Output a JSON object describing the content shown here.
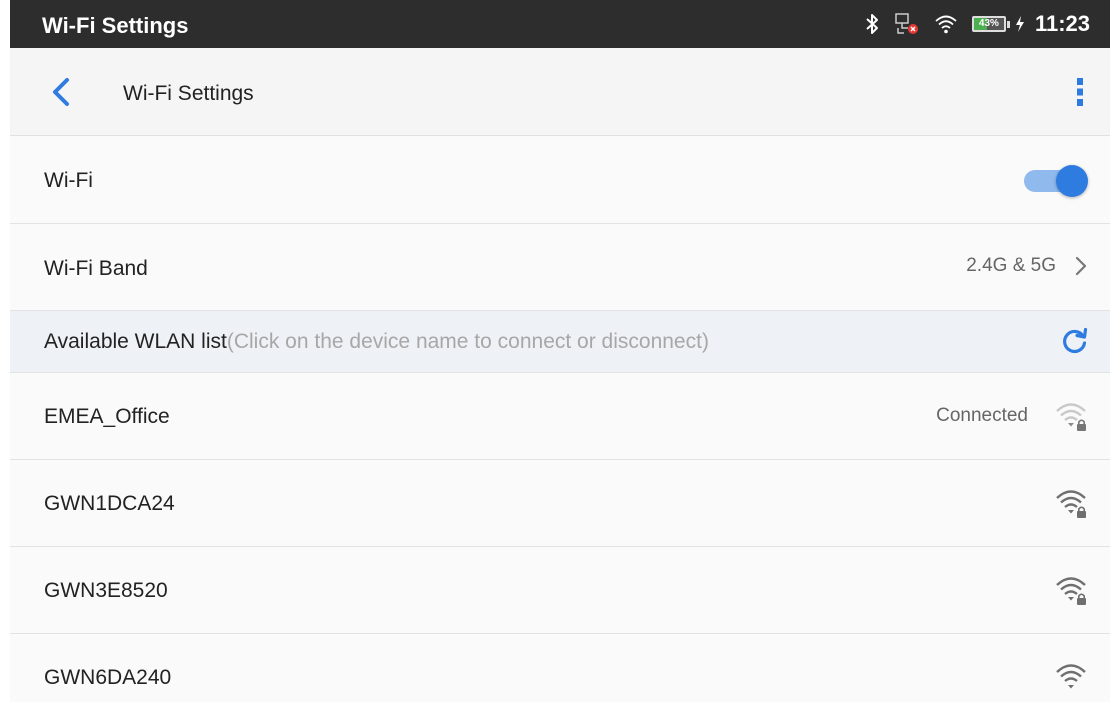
{
  "status_bar": {
    "title": "Wi-Fi Settings",
    "battery": {
      "text": "43%",
      "level": 0.43
    },
    "time": "11:23",
    "icons": [
      "bluetooth-icon",
      "ethernet-disconnected-icon",
      "wifi-icon",
      "battery-icon",
      "charging-icon"
    ]
  },
  "app_bar": {
    "title": "Wi-Fi Settings",
    "back_icon": "chevron-left-icon",
    "menu_icon": "more-vertical-icon"
  },
  "settings": {
    "wifi": {
      "label": "Wi-Fi",
      "enabled": true
    },
    "band": {
      "label": "Wi-Fi Band",
      "value": "2.4G & 5G"
    }
  },
  "wlan_list": {
    "title": "Available WLAN list",
    "hint": "(Click on the device name to connect or disconnect)",
    "refresh_icon": "refresh-icon",
    "networks": [
      {
        "name": "EMEA_Office",
        "status": "Connected",
        "secured": true
      },
      {
        "name": "GWN1DCA24",
        "status": "",
        "secured": true
      },
      {
        "name": "GWN3E8520",
        "status": "",
        "secured": true
      },
      {
        "name": "GWN6DA240",
        "status": "",
        "secured": false
      }
    ]
  },
  "colors": {
    "status_bar": "#2d2d2d",
    "accent": "#2f7ce0",
    "toggle_track": "#90b9ee",
    "section_background": "#eef2f6",
    "battery": "#4caf50"
  }
}
